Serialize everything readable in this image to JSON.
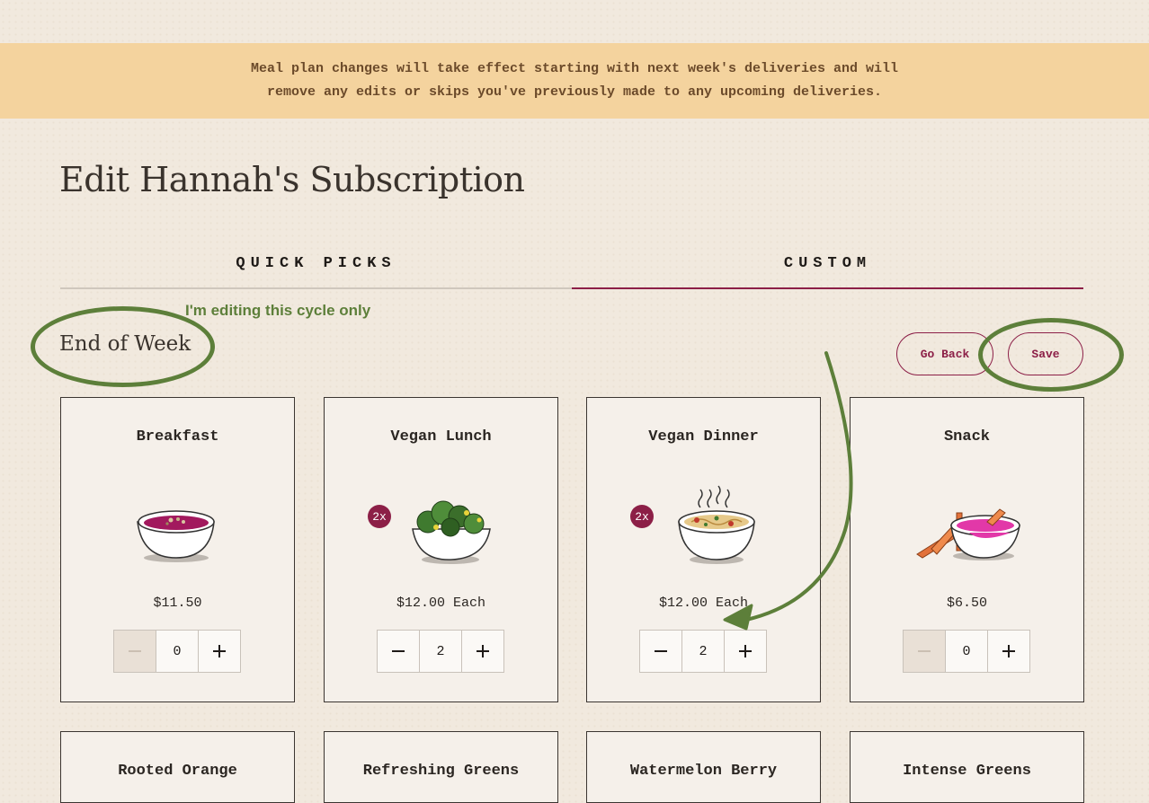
{
  "banner": {
    "line1": "Meal plan changes will take effect starting with next week's deliveries and will",
    "line2": "remove any edits or skips you've previously made to any upcoming deliveries."
  },
  "page": {
    "title": "Edit Hannah's Subscription"
  },
  "tabs": [
    {
      "label": "QUICK PICKS",
      "active": false
    },
    {
      "label": "CUSTOM",
      "active": true
    }
  ],
  "section": {
    "title": "End of Week"
  },
  "annotation": {
    "note": "I'm editing this cycle only",
    "color": "#5d7f3a"
  },
  "actions": {
    "back_label": "Go Back",
    "save_label": "Save"
  },
  "colors": {
    "accent": "#8c1f47",
    "banner": "#f4d39e",
    "background": "#f1e9de"
  },
  "meals": [
    {
      "name": "Breakfast",
      "icon": "purple-porridge-bowl-icon",
      "badge": "",
      "price": "$11.50",
      "qty": "0",
      "minus_disabled": true
    },
    {
      "name": "Vegan Lunch",
      "icon": "green-salad-bowl-icon",
      "badge": "2x",
      "price": "$12.00 Each",
      "qty": "2",
      "minus_disabled": false
    },
    {
      "name": "Vegan Dinner",
      "icon": "steaming-noodle-bowl-icon",
      "badge": "2x",
      "price": "$12.00 Each",
      "qty": "2",
      "minus_disabled": false
    },
    {
      "name": "Snack",
      "icon": "dip-with-carrots-icon",
      "badge": "",
      "price": "$6.50",
      "qty": "0",
      "minus_disabled": true
    }
  ],
  "meals_row2": [
    {
      "name": "Rooted Orange"
    },
    {
      "name": "Refreshing Greens"
    },
    {
      "name": "Watermelon Berry"
    },
    {
      "name": "Intense Greens"
    }
  ]
}
